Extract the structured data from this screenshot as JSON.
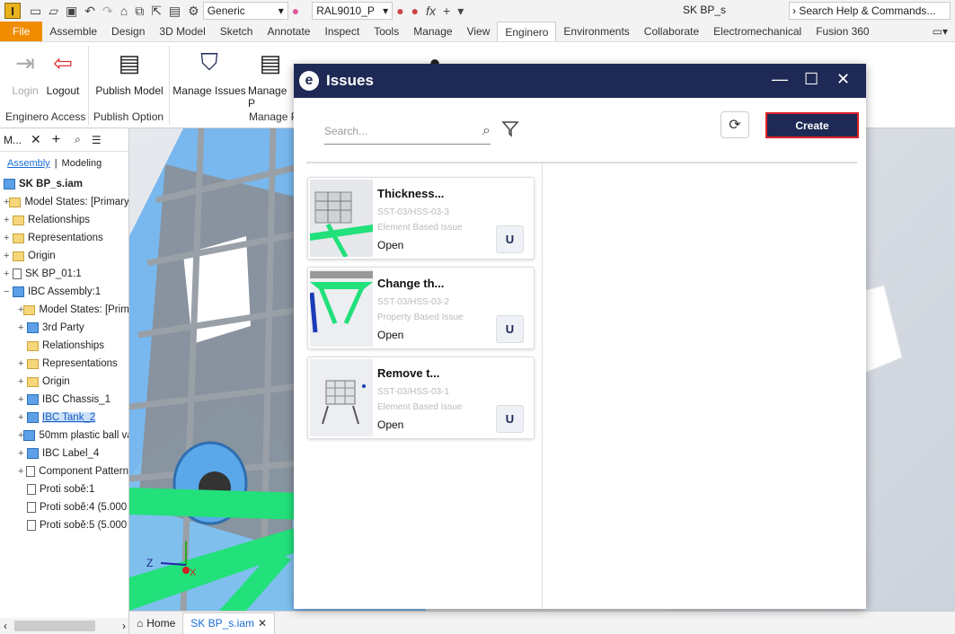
{
  "qat": {
    "app_logo": "I",
    "appearance": "Generic",
    "material": "RAL9010_P",
    "window_title": "SK BP_s",
    "search_placeholder": "Search Help & Commands..."
  },
  "tabs": [
    "File",
    "Assemble",
    "Design",
    "3D Model",
    "Sketch",
    "Annotate",
    "Inspect",
    "Tools",
    "Manage",
    "View",
    "Enginero",
    "Environments",
    "Collaborate",
    "Electromechanical",
    "Fusion 360"
  ],
  "active_tab": "Enginero",
  "ribbon": {
    "login": "Login",
    "logout": "Logout",
    "publish_model": "Publish Model",
    "manage_issues": "Manage Issues",
    "manage_p": "Manage P",
    "group_access": "Enginero Access",
    "group_publish": "Publish Option",
    "group_manage": "Manage P"
  },
  "browser": {
    "tab": "M...",
    "mode_assembly": "Assembly",
    "mode_modeling": "Modeling",
    "root": "SK BP_s.iam",
    "items": [
      {
        "label": "Model States: [Primary]",
        "pm": "+",
        "icon": "folder",
        "ind": 0
      },
      {
        "label": "Relationships",
        "pm": "+",
        "icon": "folder",
        "ind": 0
      },
      {
        "label": "Representations",
        "pm": "+",
        "icon": "folder",
        "ind": 0
      },
      {
        "label": "Origin",
        "pm": "+",
        "icon": "folder",
        "ind": 0
      },
      {
        "label": "SK BP_01:1",
        "pm": "+",
        "icon": "part",
        "ind": 0
      },
      {
        "label": "IBC Assembly:1",
        "pm": "−",
        "icon": "asm",
        "ind": 0
      },
      {
        "label": "Model States: [Prim",
        "pm": "+",
        "icon": "folder",
        "ind": 1
      },
      {
        "label": "3rd Party",
        "pm": "+",
        "icon": "asm",
        "ind": 1
      },
      {
        "label": "Relationships",
        "pm": "",
        "icon": "folder",
        "ind": 1
      },
      {
        "label": "Representations",
        "pm": "+",
        "icon": "folder",
        "ind": 1
      },
      {
        "label": "Origin",
        "pm": "+",
        "icon": "folder",
        "ind": 1
      },
      {
        "label": "IBC Chassis_1",
        "pm": "+",
        "icon": "asm",
        "ind": 1
      },
      {
        "label": "IBC Tank_2",
        "pm": "+",
        "icon": "asm",
        "ind": 1,
        "sel": true
      },
      {
        "label": "50mm plastic ball va",
        "pm": "+",
        "icon": "asm",
        "ind": 1
      },
      {
        "label": "IBC Label_4",
        "pm": "+",
        "icon": "asm",
        "ind": 1
      },
      {
        "label": "Component Pattern",
        "pm": "+",
        "icon": "pattern",
        "ind": 1
      },
      {
        "label": "Proti sobě:1",
        "pm": "",
        "icon": "constraint",
        "ind": 1
      },
      {
        "label": "Proti sobě:4 (5.000",
        "pm": "",
        "icon": "constraint",
        "ind": 1
      },
      {
        "label": "Proti sobě:5 (5.000",
        "pm": "",
        "icon": "constraint",
        "ind": 1
      }
    ]
  },
  "doc_tabs": {
    "home": "Home",
    "doc": "SK BP_s.iam"
  },
  "dialog": {
    "logo": "e",
    "title": "Issues",
    "search_placeholder": "Search...",
    "create_label": "Create",
    "issues": [
      {
        "title": "Thickness...",
        "code": "SST-03/HSS-03-3",
        "type": "Element Based Issue",
        "status": "Open",
        "badge": "U"
      },
      {
        "title": "Change th...",
        "code": "SST-03/HSS-03-2",
        "type": "Property Based Issue",
        "status": "Open",
        "badge": "U"
      },
      {
        "title": "Remove t...",
        "code": "SST-03/HSS-03-1",
        "type": "Element Based Issue",
        "status": "Open",
        "badge": "U"
      }
    ]
  },
  "axes": {
    "x": "X",
    "z": "Z"
  },
  "colors": {
    "dialog_header": "#1e2a55",
    "create_border": "#e0202a",
    "file_tab": "#f08c00",
    "frame_green": "#22e07a",
    "tank_blue": "#6db3f0"
  }
}
